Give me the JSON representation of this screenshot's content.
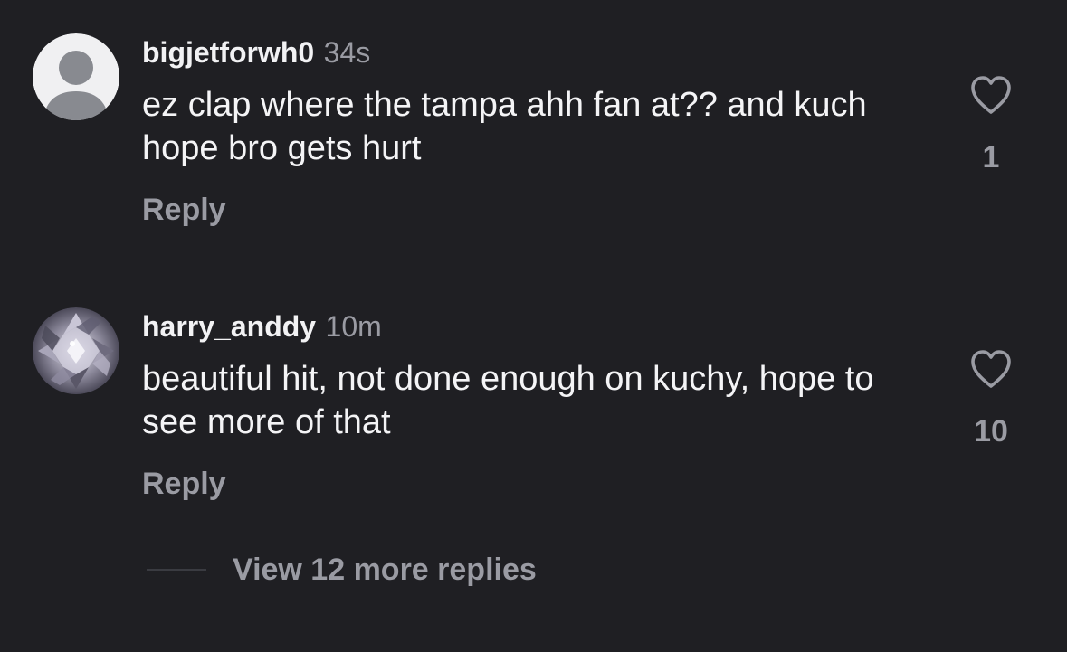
{
  "comments": [
    {
      "username": "bigjetforwh0",
      "time": "34s",
      "text": "ez clap where the tampa ahh fan at?? and kuch hope bro gets hurt",
      "reply_label": "Reply",
      "like_count": "1",
      "avatar_icon": "default-person-avatar-icon"
    },
    {
      "username": "harry_anddy",
      "time": "10m",
      "text": "beautiful hit, not done enough on kuchy, hope to see more of that",
      "reply_label": "Reply",
      "like_count": "10",
      "avatar_icon": "diamond-avatar"
    }
  ],
  "view_more_replies": "View 12 more replies",
  "colors": {
    "background": "#1f1f23",
    "primary_text": "#f2f2f4",
    "secondary_text": "#9a9ba3"
  }
}
